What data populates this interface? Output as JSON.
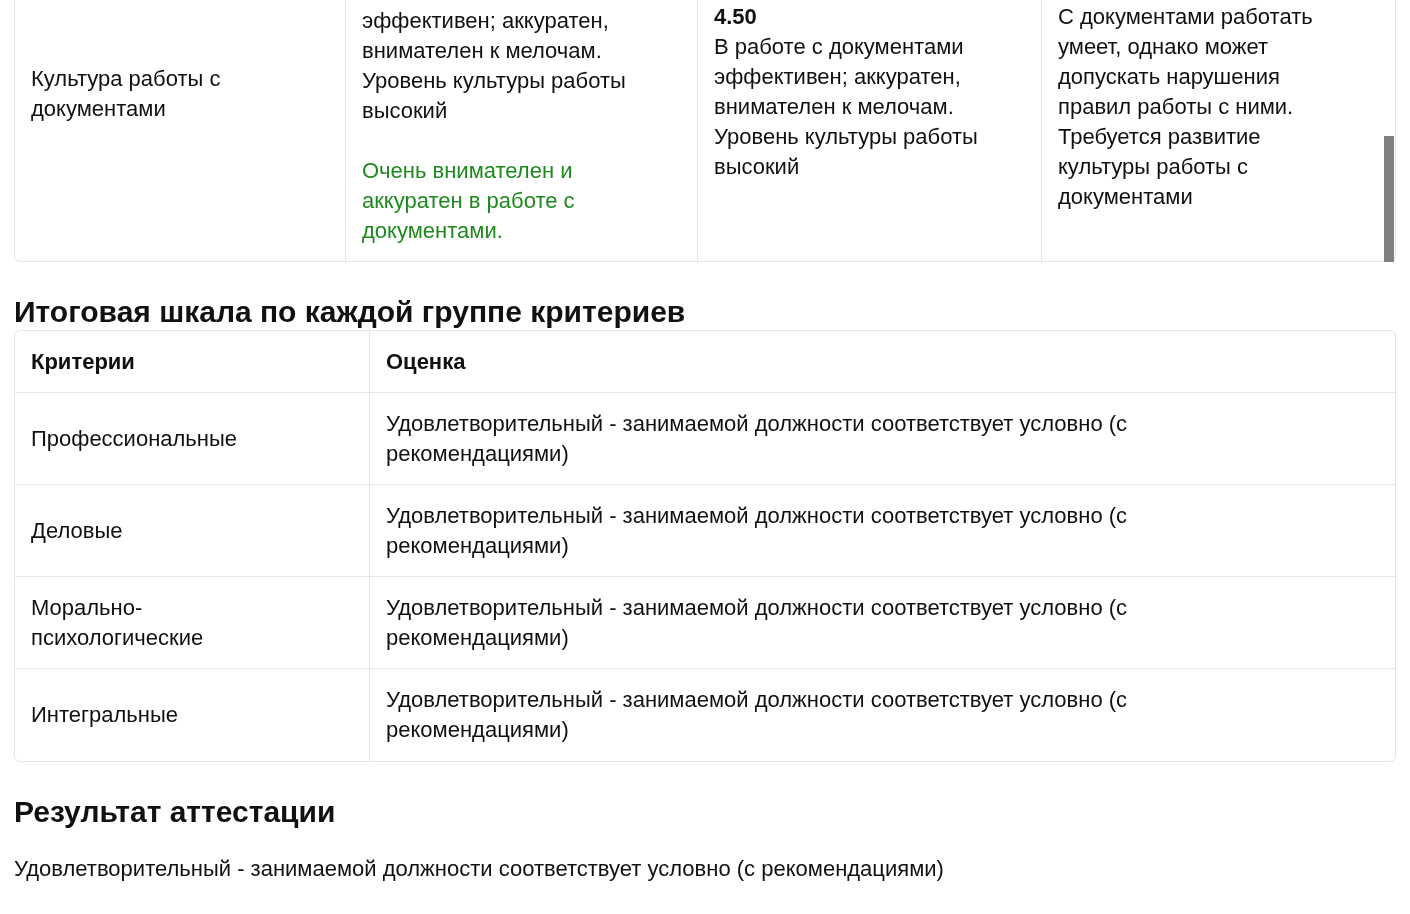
{
  "criteria_table": {
    "row": {
      "criterion": "Культура работы с документами",
      "column_2": {
        "text": "эффективен; аккуратен, внимателен к мелочам. Уровень культуры работы высокий",
        "comment": "Очень внимателен и аккуратен в работе с документами."
      },
      "column_3": {
        "score": "4.50",
        "text": "В работе с документами эффективен; аккуратен, внимателен к мелочам. Уровень культуры работы высокий"
      },
      "column_4": {
        "text": "С документами работать умеет, однако может допускать нарушения правил работы с ними. Требуется развитие культуры работы с документами"
      }
    }
  },
  "summary": {
    "title": "Итоговая шкала по каждой группе критериев",
    "columns": [
      "Критерии",
      "Оценка"
    ],
    "rows": [
      [
        "Профессиональные",
        "Удовлетворительный - занимаемой должности соответствует условно (с рекомендациями)"
      ],
      [
        "Деловые",
        "Удовлетворительный - занимаемой должности соответствует условно (с рекомендациями)"
      ],
      [
        "Морально-психологические",
        "Удовлетворительный - занимаемой должности соответствует условно (с рекомендациями)"
      ],
      [
        "Интегральные",
        "Удовлетворительный - занимаемой должности соответствует условно (с рекомендациями)"
      ]
    ]
  },
  "result": {
    "title": "Результат аттестации",
    "text": "Удовлетворительный - занимаемой должности соответствует условно (с рекомендациями)"
  }
}
